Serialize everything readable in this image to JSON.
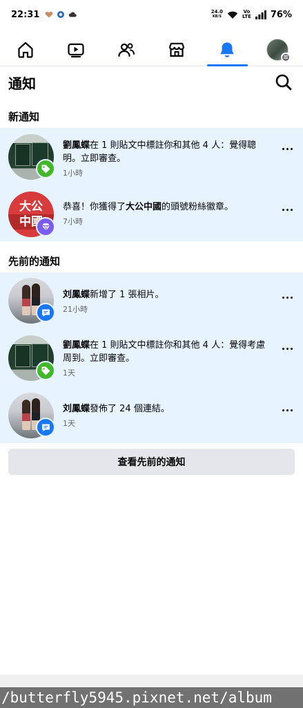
{
  "status": {
    "time": "22:31",
    "net_speed_value": "24.0",
    "net_speed_unit": "KB/S",
    "volte_top": "Vo",
    "volte_bottom": "LTE",
    "battery": "76%"
  },
  "tabs": [
    {
      "name": "home-icon",
      "active": false
    },
    {
      "name": "video-icon",
      "active": false
    },
    {
      "name": "friends-icon",
      "active": false
    },
    {
      "name": "marketplace-icon",
      "active": false
    },
    {
      "name": "bell-icon",
      "active": true
    },
    {
      "name": "profile-menu",
      "active": false
    }
  ],
  "header": {
    "title": "通知"
  },
  "sections": {
    "new_title": "新通知",
    "earlier_title": "先前的通知"
  },
  "notifications": [
    {
      "actor": "劉鳳蝶",
      "text": "在 1 則貼文中標註你和其他 4 人：覺得聰明。立即審查。",
      "time": "1小時",
      "badge": "tag-icon",
      "badge_color": "#42b72a"
    },
    {
      "prefix": "恭喜！你獲得了",
      "actor": "大公中國",
      "text": "的頭號粉絲徽章。",
      "time": "7小時",
      "badge": "diamond-icon",
      "badge_color": "#7b5cf0",
      "avatar_text_top": "大公",
      "avatar_text_bottom": "中國"
    },
    {
      "actor": "刘鳳蝶",
      "text": "新增了 1 張相片。",
      "time": "21小時",
      "badge": "comment-icon",
      "badge_color": "#1877f2"
    },
    {
      "actor": "劉鳳蝶",
      "text": "在 1 則貼文中標註你和其他 4 人：覺得考慮周到。立即審查。",
      "time": "1天",
      "badge": "tag-icon",
      "badge_color": "#42b72a"
    },
    {
      "actor": "刘鳳蝶",
      "text": "發佈了 24 個連結。",
      "time": "1天",
      "badge": "comment-icon",
      "badge_color": "#1877f2"
    }
  ],
  "view_previous_label": "查看先前的通知",
  "watermark": "/butterfly5945.pixnet.net/album",
  "colors": {
    "accent": "#1877f2",
    "unread_bg": "#e7f3ff"
  }
}
